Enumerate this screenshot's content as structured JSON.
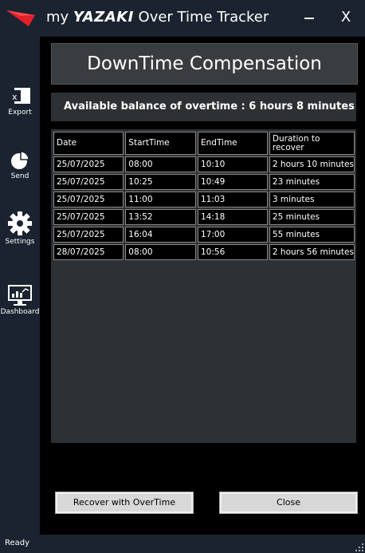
{
  "app": {
    "title_prefix": "my",
    "title_brand": "YAZAKI",
    "title_suffix": "Over Time Tracker",
    "close_label": "X"
  },
  "sidebar": {
    "items": [
      {
        "label": "Export",
        "icon": "excel-icon"
      },
      {
        "label": "Send",
        "icon": "pie-chart-icon"
      },
      {
        "label": "Settings",
        "icon": "gear-icon"
      },
      {
        "label": "Dashboard",
        "icon": "monitor-chart-icon"
      }
    ]
  },
  "main": {
    "heading": "DownTime Compensation",
    "balance": "Available balance of overtime : 6 hours 8 minutes",
    "table": {
      "headers": [
        "Date",
        "StartTime",
        "EndTime",
        "Duration to\nrecover"
      ],
      "rows": [
        [
          "25/07/2025",
          "08:00",
          "10:10",
          "2 hours 10 minutes"
        ],
        [
          "25/07/2025",
          "10:25",
          "10:49",
          "23 minutes"
        ],
        [
          "25/07/2025",
          "11:00",
          "11:03",
          "3 minutes"
        ],
        [
          "25/07/2025",
          "13:52",
          "14:18",
          "25 minutes"
        ],
        [
          "25/07/2025",
          "16:04",
          "17:00",
          "55 minutes"
        ],
        [
          "28/07/2025",
          "08:00",
          "10:56",
          "2 hours 56 minutes"
        ]
      ]
    },
    "buttons": {
      "recover": "Recover with OverTime",
      "close": "Close"
    }
  },
  "status": {
    "text": "Ready"
  },
  "colors": {
    "chrome": "#1b2330",
    "brand_red": "#e3202a",
    "panel": "#2e3134"
  }
}
